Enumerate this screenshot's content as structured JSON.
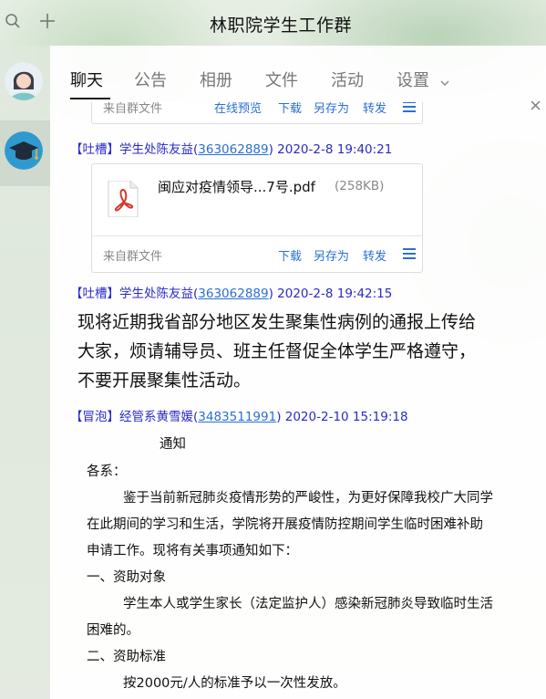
{
  "window": {
    "title": "林职院学生工作群"
  },
  "tabs": [
    {
      "label": "聊天"
    },
    {
      "label": "公告"
    },
    {
      "label": "相册"
    },
    {
      "label": "文件"
    },
    {
      "label": "活动"
    },
    {
      "label": "设置"
    }
  ],
  "file_card_top": {
    "source": "来自群文件",
    "actions": [
      "在线预览",
      "下载",
      "另存为",
      "转发"
    ]
  },
  "messages": [
    {
      "tag": "【吐槽】",
      "sender": "学生处陈友益",
      "qq": "363062889",
      "time": "2020-2-8 19:40:21",
      "file": {
        "name": "闽应对疫情领导...7号.pdf",
        "size": "(258KB)",
        "source": "来自群文件",
        "actions": [
          "下载",
          "另存为",
          "转发"
        ]
      }
    },
    {
      "tag": "【吐槽】",
      "sender": "学生处陈友益",
      "qq": "363062889",
      "time": "2020-2-8 19:42:15",
      "text_lines": [
        "现将近期我省部分地区发生聚集性病例的通报上传给",
        "大家，烦请辅导员、班主任督促全体学生严格遵守，",
        "不要开展聚集性活动。"
      ]
    },
    {
      "tag": "【冒泡】",
      "sender": "经管系黄雪媛",
      "qq": "3483511991",
      "time": "2020-2-10 15:19:18",
      "notice_lines": [
        "通知",
        "各系：",
        "鉴于当前新冠肺炎疫情形势的严峻性，为更好保障我校广大同学",
        "在此期间的学习和生活，学院将开展疫情防控期间学生临时困难补助",
        "申请工作。现将有关事项通知如下：",
        "一、资助对象",
        "学生本人或学生家长（法定监护人）感染新冠肺炎导致临时生活",
        "困难的。",
        "二、资助标准",
        "按2000元/人的标准予以一次性发放。"
      ]
    }
  ],
  "colors": {
    "link": "#2a6fd6",
    "sender": "#2a2ac8",
    "accent": "#1a1a1a"
  }
}
